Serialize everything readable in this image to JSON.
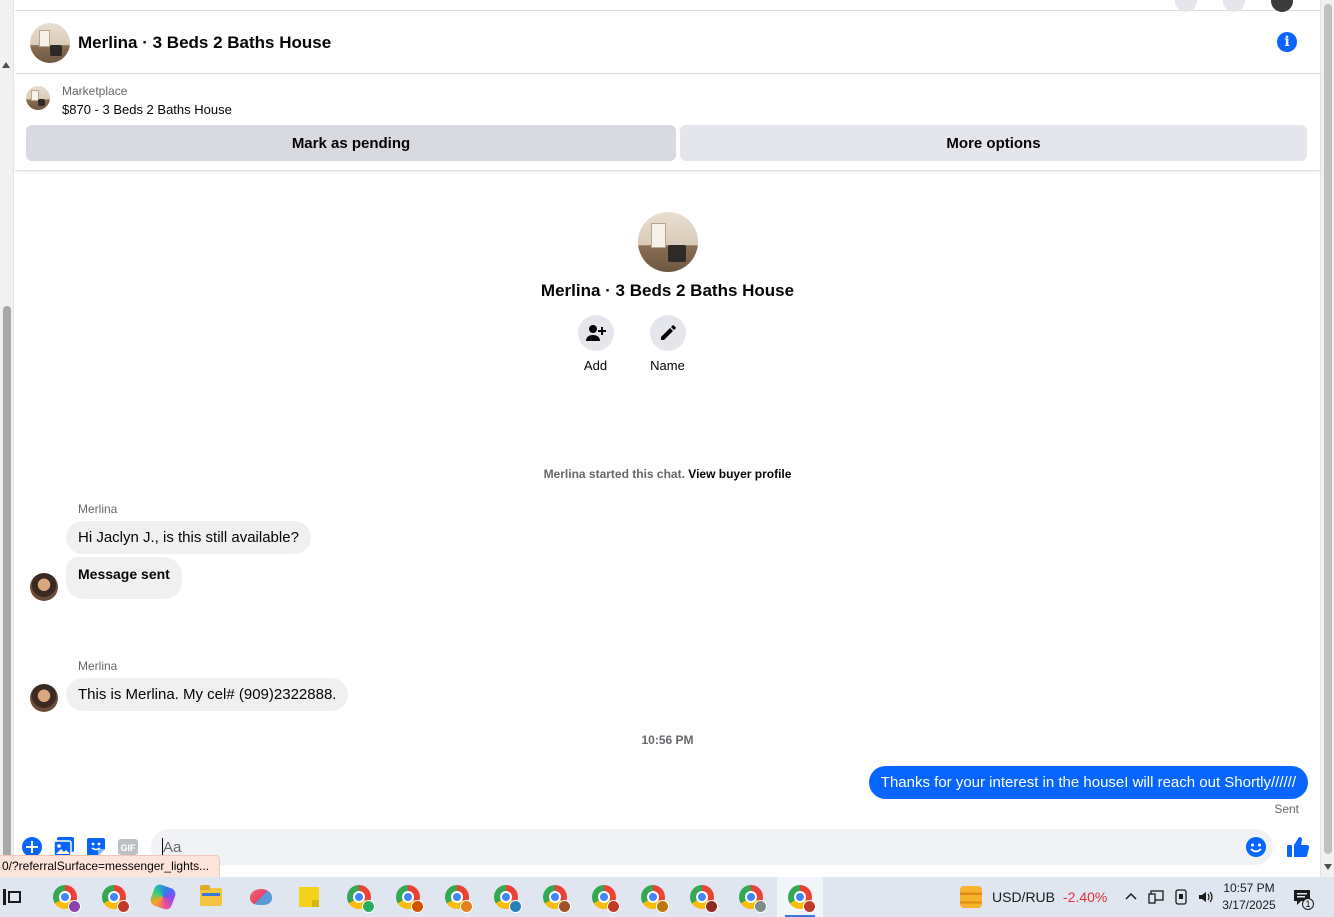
{
  "header": {
    "title": "Merlina · 3 Beds 2 Baths House"
  },
  "marketplace": {
    "label": "Marketplace",
    "listing": "$870 - 3 Beds 2 Baths House",
    "pending_button": "Mark as pending",
    "more_button": "More options"
  },
  "profile": {
    "name": "Merlina · 3 Beds 2 Baths House",
    "add_label": "Add",
    "name_label": "Name"
  },
  "chat_started": {
    "text": "Merlina started this chat.",
    "link": "View buyer profile"
  },
  "messages": [
    {
      "sender": "Merlina",
      "text": "Hi Jaclyn J., is this still available?"
    },
    {
      "text": "Message sent"
    },
    {
      "sender": "Merlina",
      "text": "This is Merlina. My cel# (909)2322888."
    }
  ],
  "timestamp": "10:56 PM",
  "outgoing": {
    "text": "Thanks for your interest in the houseI will reach out Shortly//////",
    "status": "Sent"
  },
  "composer": {
    "placeholder": "Aa"
  },
  "status_url": "0/?referralSurface=messenger_lights...",
  "taskbar": {
    "ticker_label": "USD/RUB",
    "ticker_change": "-2.40%",
    "time": "10:57 PM",
    "date": "3/17/2025",
    "notification_count": "1"
  },
  "colors": {
    "accent": "#0866ff",
    "bubble_in": "#f0f0f0",
    "ticker_negative": "#e0303b"
  },
  "icons": [
    "info-icon",
    "add-person-icon",
    "pencil-icon",
    "plus-circle-icon",
    "photo-icon",
    "sticker-icon",
    "gif-icon",
    "emoji-icon",
    "thumbs-up-icon",
    "task-view-icon",
    "chrome-icon",
    "copilot-icon",
    "file-explorer-icon",
    "snipping-tool-icon",
    "sticky-notes-icon"
  ]
}
